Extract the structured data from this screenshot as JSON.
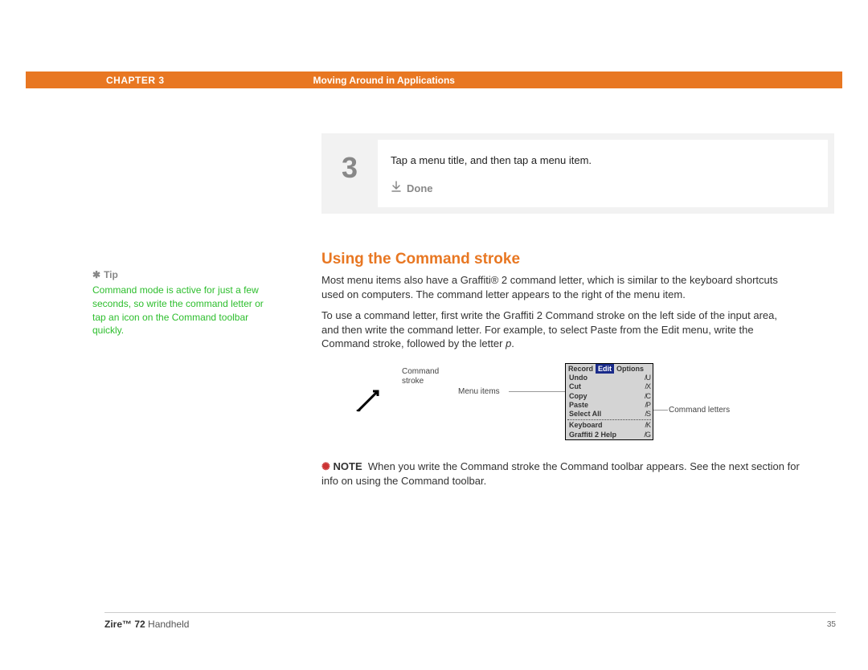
{
  "header": {
    "chapter": "CHAPTER 3",
    "title": "Moving Around in Applications"
  },
  "step": {
    "number": "3",
    "text": "Tap a menu title, and then tap a menu item.",
    "done": "Done"
  },
  "section": {
    "heading": "Using the Command stroke"
  },
  "body": {
    "p1": "Most menu items also have a Graffiti® 2 command letter, which is similar to the keyboard shortcuts used on computers. The command letter appears to the right of the menu item.",
    "p2a": "To use a command letter, first write the Graffiti 2 Command stroke on the left side of the input area, and then write the command letter. For example, to select Paste from the Edit menu, write the Command stroke, followed by the letter ",
    "p2b": "p",
    "p2c": "."
  },
  "tip": {
    "label": "Tip",
    "text": "Command mode is active for just a few seconds, so write the command letter or tap an icon on the Command toolbar quickly."
  },
  "figure": {
    "command_stroke_label": "Command stroke",
    "menu_items_label": "Menu items",
    "command_letters_label": "Command letters",
    "tabs": {
      "record": "Record",
      "edit": "Edit",
      "options": "Options"
    },
    "menu": [
      {
        "label": "Undo",
        "sc": "/U"
      },
      {
        "label": "Cut",
        "sc": "/X"
      },
      {
        "label": "Copy",
        "sc": "/C"
      },
      {
        "label": "Paste",
        "sc": "/P"
      },
      {
        "label": "Select All",
        "sc": "/S"
      }
    ],
    "menu2": [
      {
        "label": "Keyboard",
        "sc": "/K"
      },
      {
        "label": "Graffiti 2 Help",
        "sc": "/G"
      }
    ]
  },
  "note": {
    "label": "NOTE",
    "text": "When you write the Command stroke the Command toolbar appears. See the next section for info on using the Command toolbar."
  },
  "footer": {
    "product_bold": "Zire™ 72",
    "product_rest": " Handheld",
    "page": "35"
  }
}
